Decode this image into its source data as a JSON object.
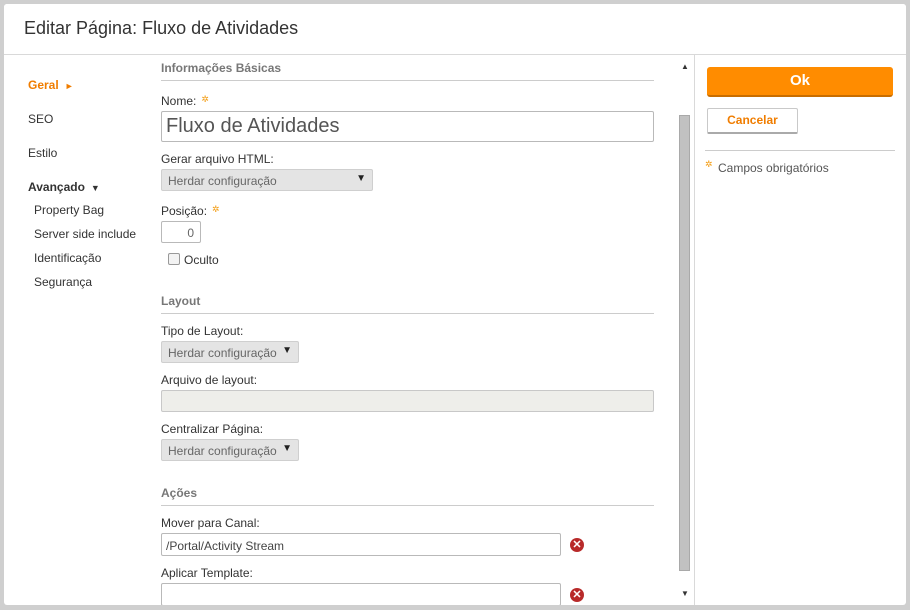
{
  "dialog": {
    "title": "Editar Página: Fluxo de Atividades"
  },
  "nav": {
    "items": [
      {
        "label": "Geral",
        "arrow": "►"
      },
      {
        "label": "SEO"
      },
      {
        "label": "Estilo"
      },
      {
        "label": "Avançado",
        "arrow": "▼"
      },
      {
        "label": "Property Bag"
      },
      {
        "label": "Server side include"
      },
      {
        "label": "Identificação"
      },
      {
        "label": "Segurança"
      }
    ]
  },
  "basic": {
    "section_title": "Informações Básicas",
    "name_label": "Nome:",
    "name_value": "Fluxo de Atividades",
    "html_label": "Gerar arquivo HTML:",
    "html_value": "Herdar configuração",
    "position_label": "Posição:",
    "position_value": "0",
    "hidden_label": "Oculto",
    "hidden_checked": false
  },
  "layout": {
    "section_title": "Layout",
    "type_label": "Tipo de Layout:",
    "type_value": "Herdar configuração",
    "file_label": "Arquivo de layout:",
    "file_value": "",
    "center_label": "Centralizar Página:",
    "center_value": "Herdar configuração"
  },
  "actions": {
    "section_title": "Ações",
    "move_label": "Mover para Canal:",
    "move_value": "/Portal/Activity Stream",
    "template_label": "Aplicar Template:",
    "template_value": ""
  },
  "side": {
    "ok_label": "Ok",
    "cancel_label": "Cancelar",
    "required_note": "Campos obrigatórios"
  },
  "icons": {
    "required": "✲",
    "caret": "▼",
    "remove": "✕",
    "scroll_up": "▲",
    "scroll_down": "▼"
  },
  "colors": {
    "accent": "#f07d00",
    "ok_button": "#ff8c00",
    "required_marker": "#f39c12",
    "remove_icon": "#b82a2a"
  }
}
